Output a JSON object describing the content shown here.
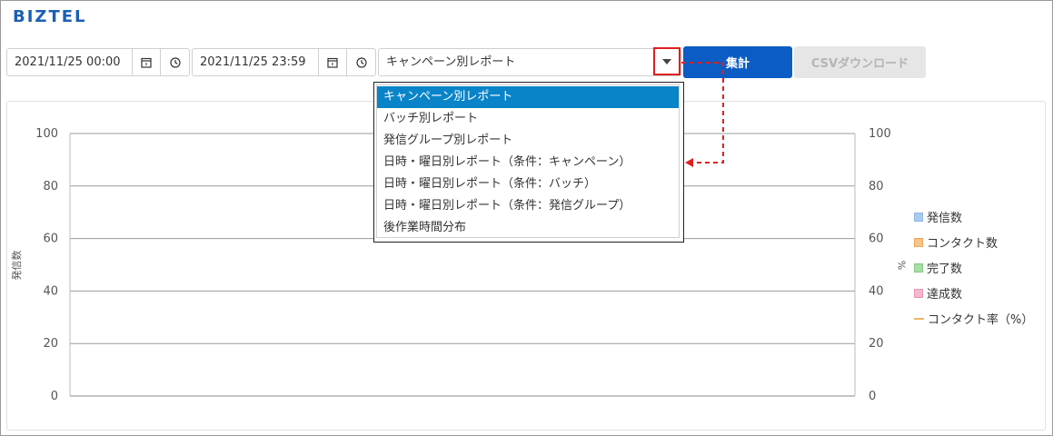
{
  "app": {
    "logo": "BIZTEL"
  },
  "filters": {
    "start_datetime": "2021/11/25 00:00",
    "end_datetime": "2021/11/25 23:59",
    "report_type": "キャンペーン別レポート",
    "submit_label": "集計",
    "csv_label": "CSVダウンロード"
  },
  "dropdown": {
    "options": [
      "キャンペーン別レポート",
      "バッチ別レポート",
      "発信グループ別レポート",
      "日時・曜日別レポート（条件：キャンペーン）",
      "日時・曜日別レポート（条件：バッチ）",
      "日時・曜日別レポート（条件：発信グループ）",
      "後作業時間分布"
    ],
    "selected_index": 0
  },
  "chart_data": {
    "type": "bar",
    "ylabel": "発信数",
    "y2label": "%",
    "ylim": [
      0,
      100
    ],
    "y2lim": [
      0,
      100
    ],
    "yticks": [
      "100",
      "80",
      "60",
      "40",
      "20",
      "0"
    ],
    "y2ticks": [
      "100",
      "80",
      "60",
      "40",
      "20",
      "0"
    ],
    "grid": true,
    "legend_position": "right",
    "series": [
      {
        "name": "発信数",
        "color": "#a9cbee",
        "values": []
      },
      {
        "name": "コンタクト数",
        "color": "#f5c58a",
        "values": []
      },
      {
        "name": "完了数",
        "color": "#a9dca9",
        "values": []
      },
      {
        "name": "達成数",
        "color": "#f5b8cf",
        "values": []
      },
      {
        "name": "コンタクト率（%）",
        "color": "#e8b86a",
        "type": "line",
        "values": []
      }
    ]
  },
  "colors": {
    "annotation": "#e02020",
    "primary": "#0b5cc4",
    "selected_option": "#0a84c8"
  }
}
